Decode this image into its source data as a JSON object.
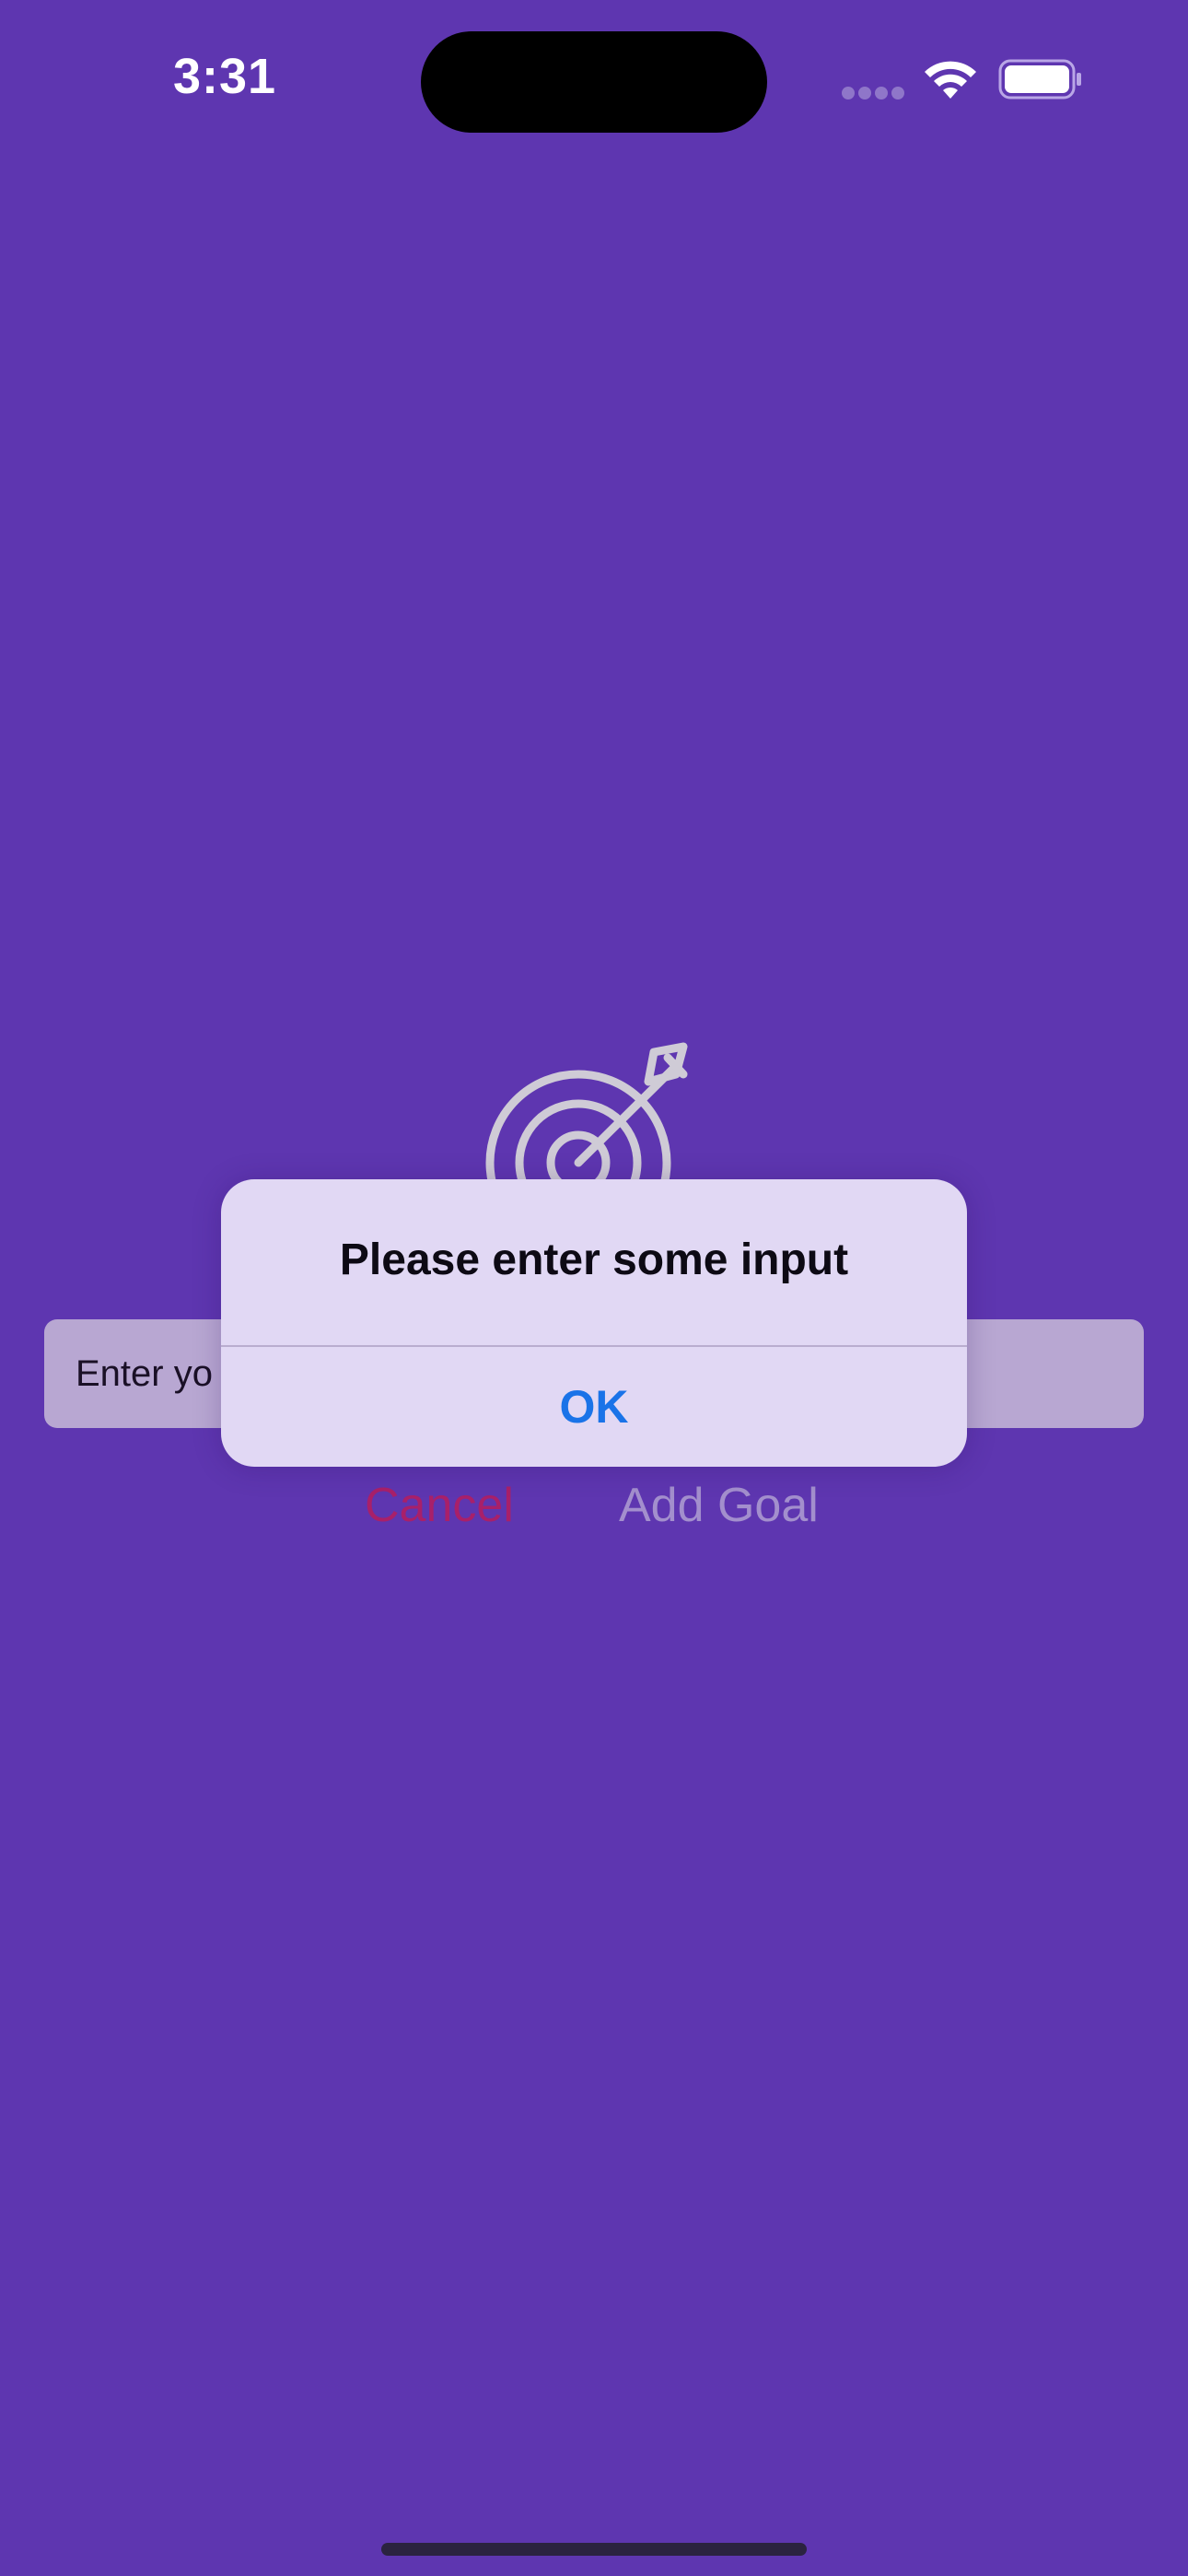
{
  "status_bar": {
    "time": "3:31",
    "wifi_icon": "wifi-icon",
    "battery_icon": "battery-icon"
  },
  "main": {
    "icon": "target-arrow-icon",
    "goal_input": {
      "value": "Enter yo",
      "placeholder": "Enter yo"
    },
    "cancel_label": "Cancel",
    "add_goal_label": "Add Goal"
  },
  "alert": {
    "title": "Please enter some input",
    "ok_label": "OK"
  },
  "colors": {
    "background": "#5e36b0",
    "cancel": "#a8206a",
    "add_goal": "#a38fcd",
    "alert_background": "#e1d8f4",
    "ok": "#1a73e8"
  }
}
